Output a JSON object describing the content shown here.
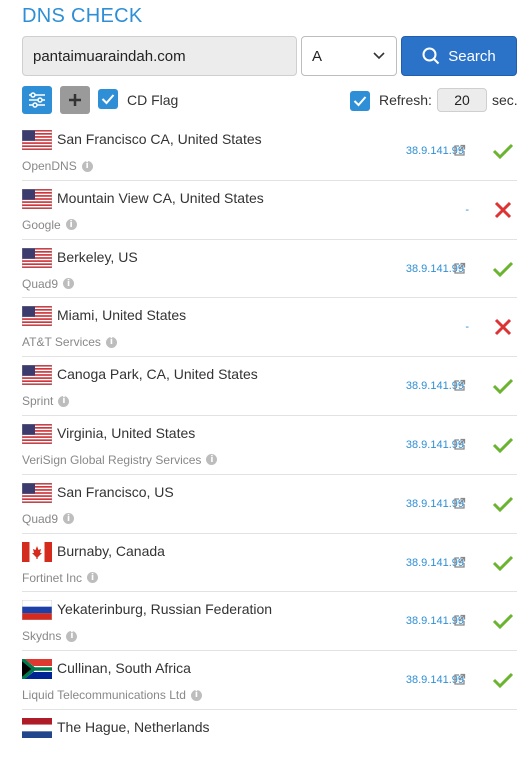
{
  "header": {
    "title": "DNS CHECK"
  },
  "form": {
    "domain_value": "pantaimuaraindah.com",
    "record_type": "A",
    "search_label": "Search"
  },
  "options": {
    "cd_flag_label": "CD Flag",
    "refresh_label": "Refresh:",
    "refresh_value": "20",
    "refresh_unit": "sec."
  },
  "colors": {
    "accent": "#2e8fd6",
    "ok": "#6ab42f",
    "fail": "#dd3333"
  },
  "results": [
    {
      "flag": "us",
      "location": "San Francisco CA, United States",
      "provider": "OpenDNS",
      "ip": "38.9.141.99",
      "status": "ok"
    },
    {
      "flag": "us",
      "location": "Mountain View CA, United States",
      "provider": "Google",
      "ip": "-",
      "status": "fail"
    },
    {
      "flag": "us",
      "location": "Berkeley, US",
      "provider": "Quad9",
      "ip": "38.9.141.99",
      "status": "ok"
    },
    {
      "flag": "us",
      "location": "Miami, United States",
      "provider": "AT&T Services",
      "ip": "-",
      "status": "fail"
    },
    {
      "flag": "us",
      "location": "Canoga Park, CA, United States",
      "provider": "Sprint",
      "ip": "38.9.141.99",
      "status": "ok"
    },
    {
      "flag": "us",
      "location": "Virginia, United States",
      "provider": "VeriSign Global Registry Services",
      "ip": "38.9.141.99",
      "status": "ok"
    },
    {
      "flag": "us",
      "location": "San Francisco, US",
      "provider": "Quad9",
      "ip": "38.9.141.99",
      "status": "ok"
    },
    {
      "flag": "ca",
      "location": "Burnaby, Canada",
      "provider": "Fortinet Inc",
      "ip": "38.9.141.99",
      "status": "ok"
    },
    {
      "flag": "ru",
      "location": "Yekaterinburg, Russian Federation",
      "provider": "Skydns",
      "ip": "38.9.141.99",
      "status": "ok"
    },
    {
      "flag": "za",
      "location": "Cullinan, South Africa",
      "provider": "Liquid Telecommunications Ltd",
      "ip": "38.9.141.99",
      "status": "ok"
    },
    {
      "flag": "nl",
      "location": "The Hague, Netherlands",
      "provider": "",
      "ip": "",
      "status": ""
    }
  ]
}
